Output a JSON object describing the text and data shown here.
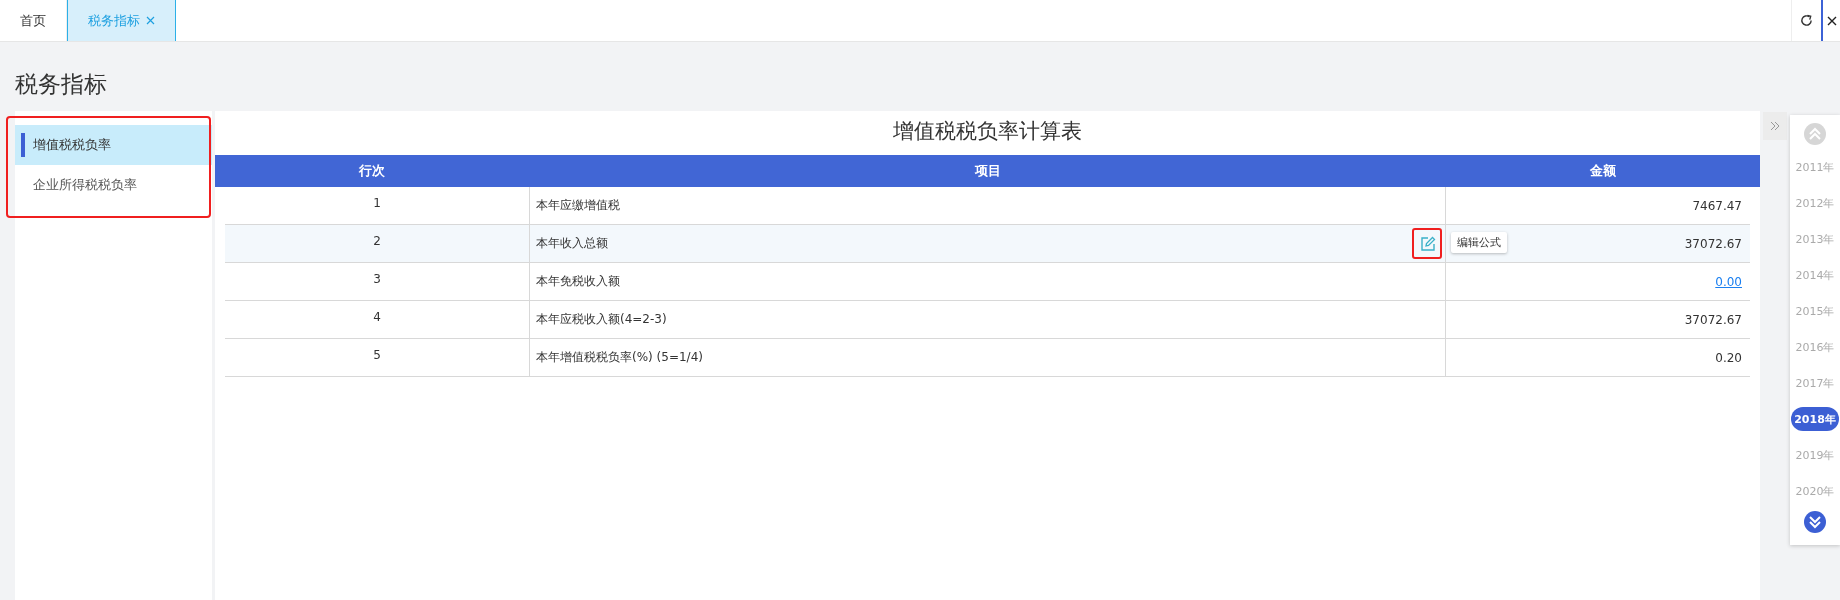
{
  "tabs": [
    {
      "label": "首页",
      "selected": false,
      "closable": false
    },
    {
      "label": "税务指标",
      "selected": true,
      "closable": true
    }
  ],
  "page_title": "税务指标",
  "sidebar": {
    "annotated": true,
    "items": [
      {
        "label": "增值税税负率",
        "selected": true
      },
      {
        "label": "企业所得税税负率",
        "selected": false
      }
    ]
  },
  "table": {
    "title": "增值税税负率计算表",
    "columns": [
      "行次",
      "项目",
      "金额"
    ],
    "rows": [
      {
        "no": "1",
        "item": "本年应缴增值税",
        "amount": "7467.47",
        "kind": "text",
        "hovered": false
      },
      {
        "no": "2",
        "item": "本年收入总额",
        "amount": "37072.67",
        "kind": "text",
        "hovered": true,
        "edit_annotated": true,
        "tooltip": "编辑公式"
      },
      {
        "no": "3",
        "item": "本年免税收入额",
        "amount": "0.00",
        "kind": "link",
        "hovered": false
      },
      {
        "no": "4",
        "item": "本年应税收入额(4=2-3)",
        "amount": "37072.67",
        "kind": "text",
        "hovered": false
      },
      {
        "no": "5",
        "item": "本年增值税税负率(%) (5=1/4)",
        "amount": "0.20",
        "kind": "text",
        "hovered": false
      }
    ]
  },
  "years": [
    {
      "label": "2011年",
      "selected": false
    },
    {
      "label": "2012年",
      "selected": false
    },
    {
      "label": "2013年",
      "selected": false
    },
    {
      "label": "2014年",
      "selected": false
    },
    {
      "label": "2015年",
      "selected": false
    },
    {
      "label": "2016年",
      "selected": false
    },
    {
      "label": "2017年",
      "selected": false
    },
    {
      "label": "2018年",
      "selected": true
    },
    {
      "label": "2019年",
      "selected": false
    },
    {
      "label": "2020年",
      "selected": false
    }
  ]
}
